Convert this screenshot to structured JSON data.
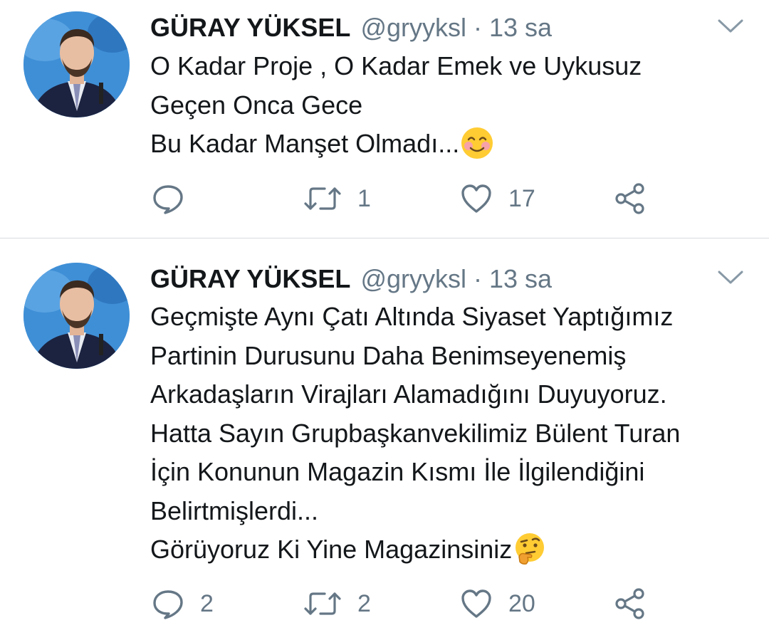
{
  "tweets": [
    {
      "name": "GÜRAY YÜKSEL",
      "handle": "@gryyksl",
      "separator": "·",
      "time": "13 sa",
      "lines": [
        "O Kadar Proje , O Kadar Emek ve Uykusuz",
        "Geçen Onca Gece",
        "Bu Kadar Manşet Olmadı..."
      ],
      "emoji": "smiling-face-with-blush-emoji",
      "reply_count": "",
      "retweet_count": "1",
      "like_count": "17"
    },
    {
      "name": "GÜRAY YÜKSEL",
      "handle": "@gryyksl",
      "separator": "·",
      "time": "13 sa",
      "lines": [
        "Geçmişte Aynı Çatı Altında  Siyaset Yaptığımız",
        "Partinin Durusunu Daha Benimseyenemiş",
        "Arkadaşların Virajları Alamadığını Duyuyoruz.",
        "Hatta Sayın Grupbaşkanvekilimiz Bülent Turan",
        "İçin Konunun Magazin Kısmı İle İlgilendiğini",
        "Belirtmişlerdi...",
        "Görüyoruz Ki Yine Magazinsiniz"
      ],
      "emoji": "thinking-face-emoji",
      "reply_count": "2",
      "retweet_count": "2",
      "like_count": "20"
    }
  ],
  "icons": {
    "reply": "reply-icon",
    "retweet": "retweet-icon",
    "like": "heart-icon",
    "share": "share-icon",
    "caret": "chevron-down-icon"
  },
  "colors": {
    "text": "#14171a",
    "secondary": "#657786",
    "divider": "#d6dade",
    "avatar_bg": "#3f8fd6"
  }
}
